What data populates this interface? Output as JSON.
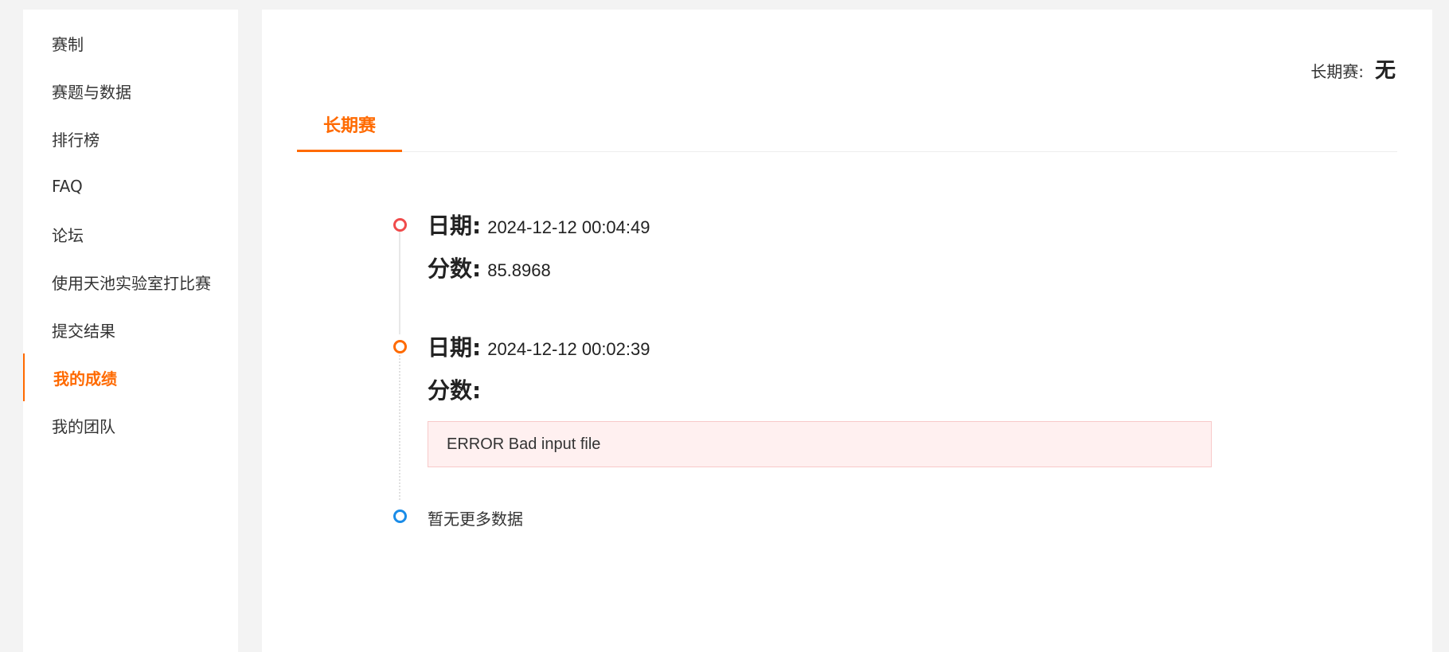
{
  "sidebar": {
    "items": [
      {
        "label": "赛制",
        "active": false
      },
      {
        "label": "赛题与数据",
        "active": false
      },
      {
        "label": "排行榜",
        "active": false
      },
      {
        "label": "FAQ",
        "active": false
      },
      {
        "label": "论坛",
        "active": false
      },
      {
        "label": "使用天池实验室打比赛",
        "active": false
      },
      {
        "label": "提交结果",
        "active": false
      },
      {
        "label": "我的成绩",
        "active": true
      },
      {
        "label": "我的团队",
        "active": false
      }
    ]
  },
  "header": {
    "long_term_label": "长期赛:",
    "long_term_value": "无"
  },
  "tabs": [
    {
      "label": "长期赛",
      "active": true
    }
  ],
  "timeline": {
    "date_key": "日期:",
    "score_key": "分数:",
    "entries": [
      {
        "date": "2024-12-12 00:04:49",
        "score": "85.8968",
        "error": null,
        "dot_color": "#f04b4b"
      },
      {
        "date": "2024-12-12 00:02:39",
        "score": "",
        "error": "ERROR Bad input file",
        "dot_color": "#ff6a00"
      }
    ],
    "end_text": "暂无更多数据",
    "end_dot_color": "#1a8ce8"
  },
  "colors": {
    "accent": "#ff6a00",
    "error_bg": "#fff0f0",
    "error_border": "#f8c9c9"
  }
}
